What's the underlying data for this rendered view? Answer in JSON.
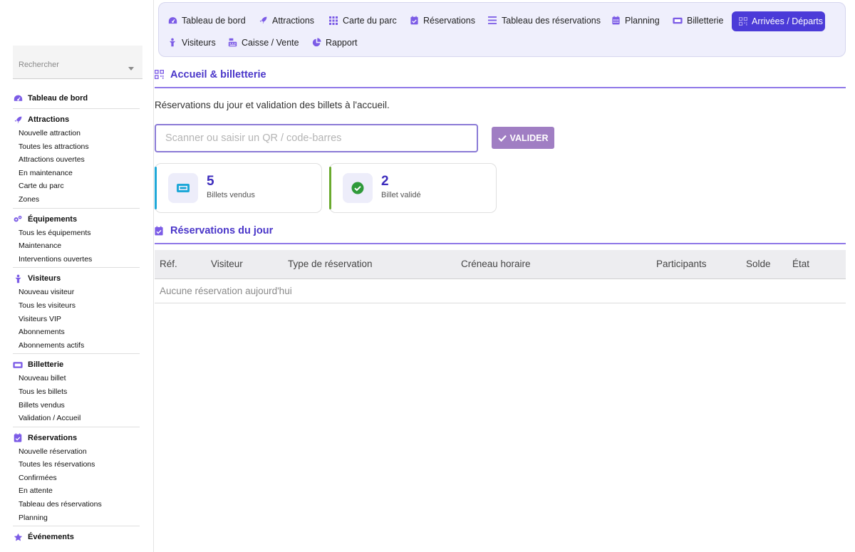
{
  "colors": {
    "accent": "#4b3bd8",
    "heading": "#4a36c9",
    "icon": "#7c5ce6",
    "validate_button": "#a07ec3",
    "ticket_bar": "#1ea8d8",
    "check_bar": "#6aaa2e"
  },
  "sidebar": {
    "search_label": "Rechercher",
    "groups": [
      {
        "label": "Tableau de bord",
        "icon": "dashboard-icon",
        "items": []
      },
      {
        "label": "Attractions",
        "icon": "rocket-icon",
        "items": [
          "Nouvelle attraction",
          "Toutes les attractions",
          "Attractions ouvertes",
          "En maintenance",
          "Carte du parc",
          "Zones"
        ]
      },
      {
        "label": "Équipements",
        "icon": "gears-icon",
        "items": [
          "Tous les équipements",
          "Maintenance",
          "Interventions ouvertes"
        ]
      },
      {
        "label": "Visiteurs",
        "icon": "person-icon",
        "items": [
          "Nouveau visiteur",
          "Tous les visiteurs",
          "Visiteurs VIP",
          "Abonnements",
          "Abonnements actifs"
        ]
      },
      {
        "label": "Billetterie",
        "icon": "ticket-icon",
        "items": [
          "Nouveau billet",
          "Tous les billets",
          "Billets vendus",
          "Validation / Accueil"
        ]
      },
      {
        "label": "Réservations",
        "icon": "calendar-check-icon",
        "items": [
          "Nouvelle réservation",
          "Toutes les réservations",
          "Confirmées",
          "En attente",
          "Tableau des réservations",
          "Planning"
        ]
      },
      {
        "label": "Événements",
        "icon": "star-icon",
        "items": []
      }
    ]
  },
  "topnav": {
    "tabs": [
      {
        "label": "Tableau de bord",
        "icon": "dashboard-icon"
      },
      {
        "label": "Attractions",
        "icon": "rocket-icon"
      },
      {
        "label": "Carte du parc",
        "icon": "grid-icon"
      },
      {
        "label": "Réservations",
        "icon": "calendar-check-icon"
      },
      {
        "label": "Tableau des réservations",
        "icon": "list-icon"
      },
      {
        "label": "Planning",
        "icon": "calendar-icon"
      },
      {
        "label": "Billetterie",
        "icon": "ticket-icon"
      },
      {
        "label": "Arrivées / Départs",
        "icon": "qr-icon",
        "active": true
      },
      {
        "label": "Visiteurs",
        "icon": "person-icon"
      },
      {
        "label": "Caisse / Vente",
        "icon": "cash-register-icon"
      },
      {
        "label": "Rapport",
        "icon": "pie-chart-icon"
      }
    ]
  },
  "main": {
    "title": "Accueil & billetterie",
    "description": "Réservations du jour et validation des billets à l'accueil.",
    "scan_placeholder": "Scanner ou saisir un QR / code-barres",
    "validate_label": "VALIDER",
    "stats": [
      {
        "value": "5",
        "label": "Billets vendus",
        "icon": "ticket-icon"
      },
      {
        "value": "2",
        "label": "Billet validé",
        "icon": "check-circle-icon"
      }
    ],
    "reservations": {
      "title": "Réservations du jour",
      "columns": [
        "Réf.",
        "Visiteur",
        "Type de réservation",
        "Créneau horaire",
        "Participants",
        "Solde",
        "État"
      ],
      "empty_message": "Aucune réservation aujourd'hui"
    }
  }
}
